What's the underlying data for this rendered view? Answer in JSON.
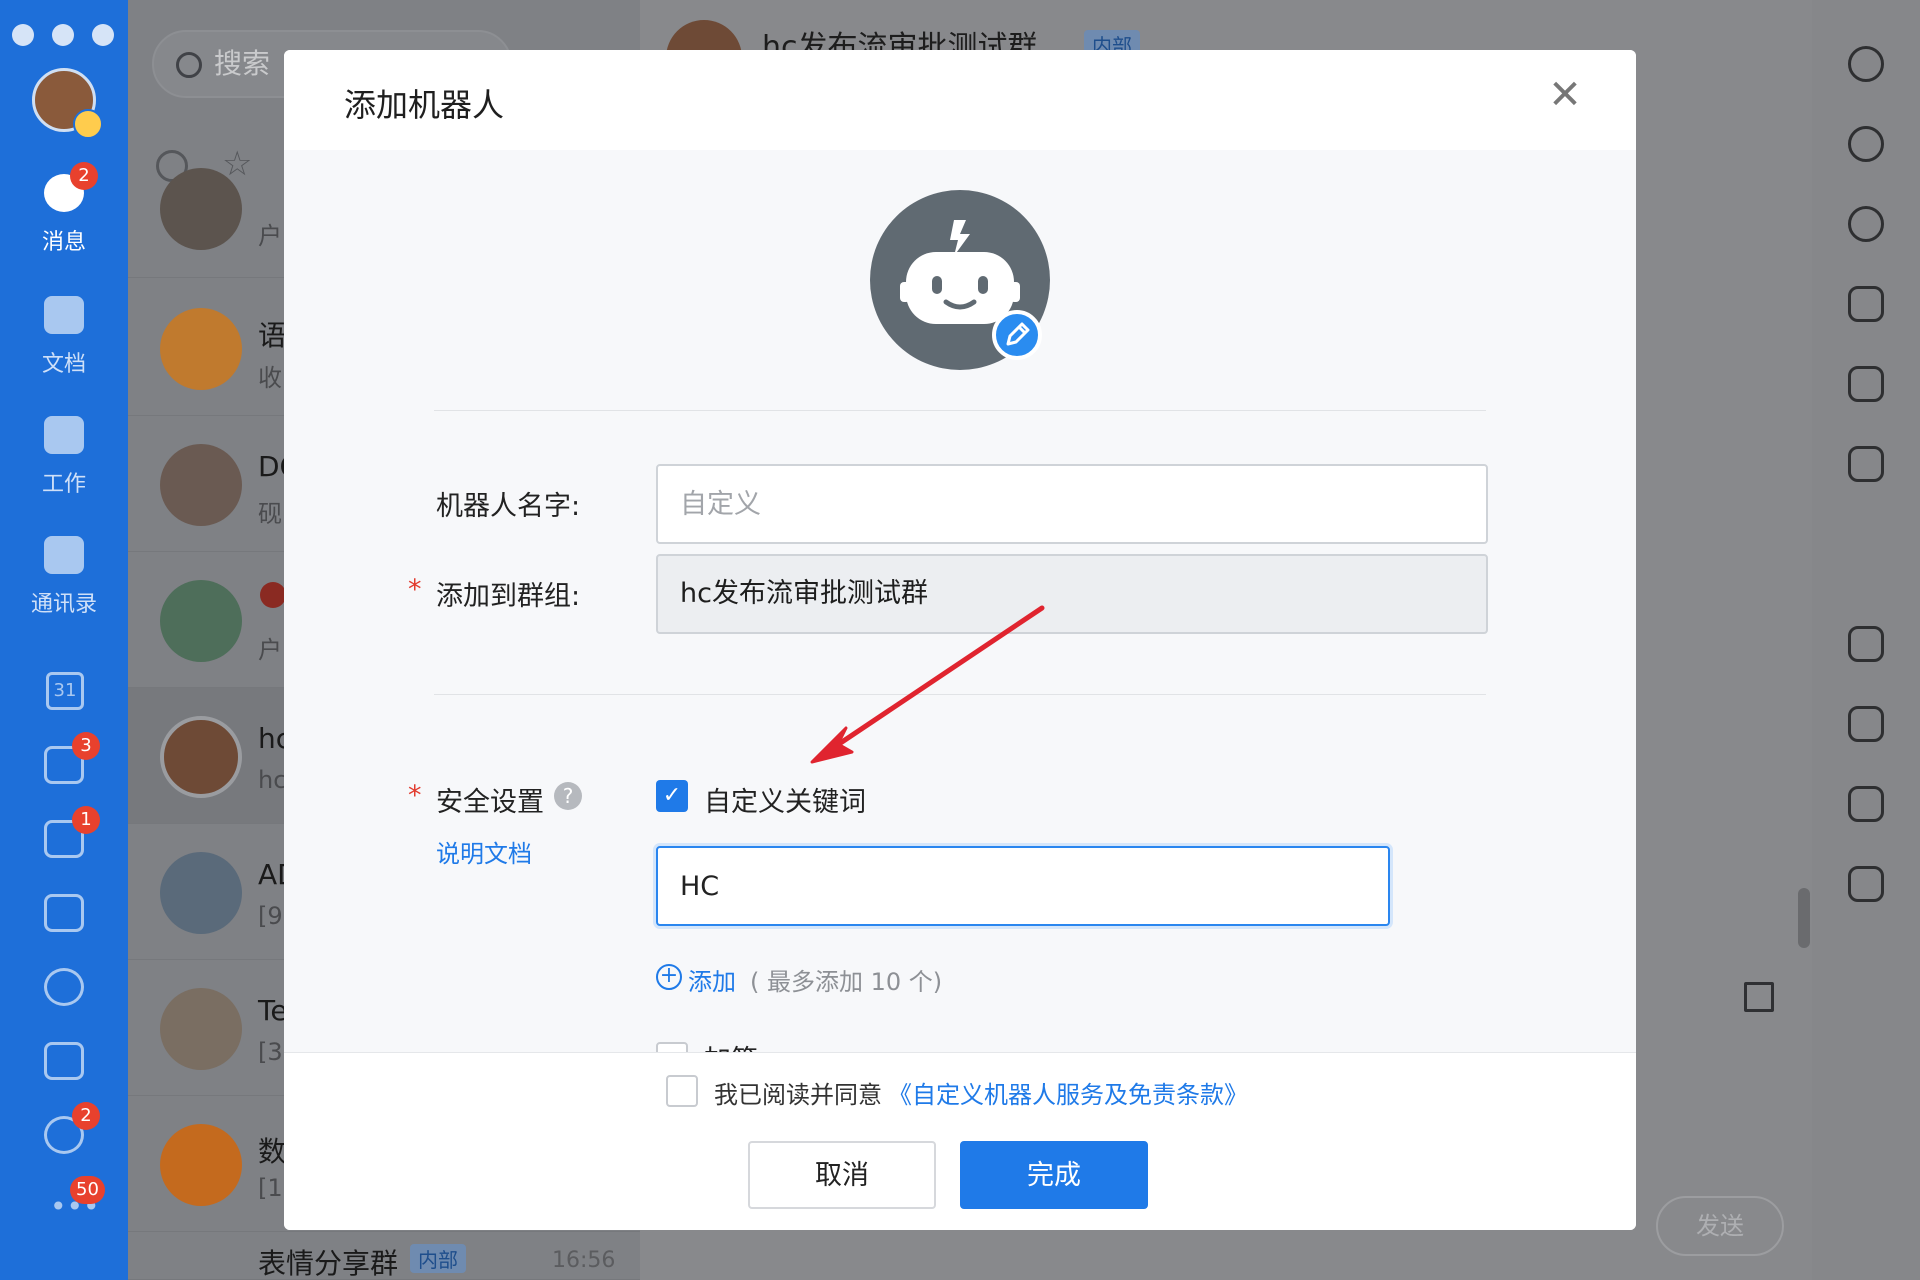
{
  "nav": {
    "items": [
      {
        "label": "消息",
        "badge": "2"
      },
      {
        "label": "文档"
      },
      {
        "label": "工作"
      },
      {
        "label": "通讯录"
      }
    ],
    "calendar_day": "31",
    "extra_badges": [
      "3",
      "1",
      "2",
      "50"
    ]
  },
  "list": {
    "search_placeholder": "搜索",
    "conversations": [
      {
        "name": "",
        "sub": "户"
      },
      {
        "name": "语",
        "sub": "收"
      },
      {
        "name": "DO",
        "sub": "砚"
      },
      {
        "name": "",
        "sub": "户"
      },
      {
        "name": "hc",
        "sub": "hc"
      },
      {
        "name": "AD",
        "sub": "[9"
      },
      {
        "name": "Te",
        "sub": "[3"
      },
      {
        "name": "数",
        "sub": "[1"
      }
    ],
    "last_item": {
      "name": "表情分享群",
      "tag": "内部",
      "time": "16:56"
    }
  },
  "chat": {
    "title": "hc发布流审批测试群",
    "tag": "内部",
    "send_label": "发送"
  },
  "modal": {
    "title": "添加机器人",
    "close_glyph": "✕",
    "name_label": "机器人名字:",
    "name_placeholder": "自定义",
    "group_label": "添加到群组:",
    "group_value": "hc发布流审批测试群",
    "required_mark": "*",
    "security_label": "安全设置",
    "help_glyph": "?",
    "doc_link": "说明文档",
    "keyword_option": "自定义关键词",
    "keyword_value": "HC",
    "add_label": "添加",
    "add_hint": "( 最多添加 10 个)",
    "sign_option": "加签",
    "agree_text": "我已阅读并同意",
    "agree_link": "《自定义机器人服务及免责条款》",
    "cancel_label": "取消",
    "done_label": "完成"
  },
  "colors": {
    "accent": "#1f7ae8",
    "nav_bg": "#1e6fd9",
    "required": "#e23b2e",
    "annotation_arrow": "#e0242f"
  }
}
